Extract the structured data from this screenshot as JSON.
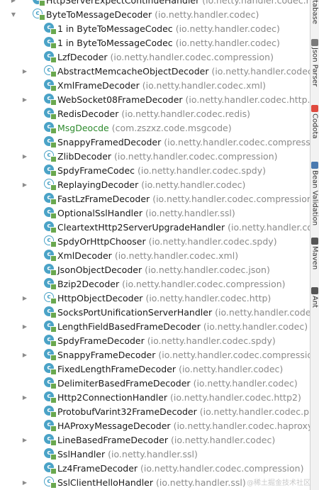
{
  "tree": {
    "rows": [
      {
        "name": "HttpServerExpectContinueHandler",
        "pkg": "(io.netty.handler.codec.http",
        "depth": 0,
        "arrow": "right",
        "icon": "class"
      },
      {
        "name": "ByteToMessageDecoder",
        "pkg": "(io.netty.handler.codec)",
        "depth": 0,
        "arrow": "down",
        "icon": "abstract"
      },
      {
        "name": "1 in ByteToMessageCodec",
        "pkg": "(io.netty.handler.codec)",
        "depth": 1,
        "arrow": "",
        "icon": "class"
      },
      {
        "name": "1 in ByteToMessageCodec",
        "pkg": "(io.netty.handler.codec)",
        "depth": 1,
        "arrow": "",
        "icon": "class"
      },
      {
        "name": "LzfDecoder",
        "pkg": "(io.netty.handler.codec.compression)",
        "depth": 1,
        "arrow": "",
        "icon": "class"
      },
      {
        "name": "AbstractMemcacheObjectDecoder",
        "pkg": "(io.netty.handler.codec.m",
        "depth": 1,
        "arrow": "right",
        "icon": "abstract"
      },
      {
        "name": "XmlFrameDecoder",
        "pkg": "(io.netty.handler.codec.xml)",
        "depth": 1,
        "arrow": "",
        "icon": "class"
      },
      {
        "name": "WebSocket08FrameDecoder",
        "pkg": "(io.netty.handler.codec.http.we",
        "depth": 1,
        "arrow": "right",
        "icon": "class"
      },
      {
        "name": "RedisDecoder",
        "pkg": "(io.netty.handler.codec.redis)",
        "depth": 1,
        "arrow": "",
        "icon": "class"
      },
      {
        "name": "MsgDeocde",
        "pkg": "(com.zszxz.code.msgcode)",
        "depth": 1,
        "arrow": "",
        "icon": "class",
        "selected": true
      },
      {
        "name": "SnappyFramedDecoder",
        "pkg": "(io.netty.handler.codec.compressio",
        "depth": 1,
        "arrow": "",
        "icon": "class"
      },
      {
        "name": "ZlibDecoder",
        "pkg": "(io.netty.handler.codec.compression)",
        "depth": 1,
        "arrow": "right",
        "icon": "abstract"
      },
      {
        "name": "SpdyFrameCodec",
        "pkg": "(io.netty.handler.codec.spdy)",
        "depth": 1,
        "arrow": "",
        "icon": "class"
      },
      {
        "name": "ReplayingDecoder",
        "pkg": "(io.netty.handler.codec)",
        "depth": 1,
        "arrow": "right",
        "icon": "abstract"
      },
      {
        "name": "FastLzFrameDecoder",
        "pkg": "(io.netty.handler.codec.compression)",
        "depth": 1,
        "arrow": "",
        "icon": "class"
      },
      {
        "name": "OptionalSslHandler",
        "pkg": "(io.netty.handler.ssl)",
        "depth": 1,
        "arrow": "",
        "icon": "class"
      },
      {
        "name": "CleartextHttp2ServerUpgradeHandler",
        "pkg": "(io.netty.handler.cod",
        "depth": 1,
        "arrow": "",
        "icon": "class"
      },
      {
        "name": "SpdyOrHttpChooser",
        "pkg": "(io.netty.handler.codec.spdy)",
        "depth": 1,
        "arrow": "",
        "icon": "abstract"
      },
      {
        "name": "XmlDecoder",
        "pkg": "(io.netty.handler.codec.xml)",
        "depth": 1,
        "arrow": "",
        "icon": "class"
      },
      {
        "name": "JsonObjectDecoder",
        "pkg": "(io.netty.handler.codec.json)",
        "depth": 1,
        "arrow": "",
        "icon": "class"
      },
      {
        "name": "Bzip2Decoder",
        "pkg": "(io.netty.handler.codec.compression)",
        "depth": 1,
        "arrow": "",
        "icon": "class"
      },
      {
        "name": "HttpObjectDecoder",
        "pkg": "(io.netty.handler.codec.http)",
        "depth": 1,
        "arrow": "right",
        "icon": "abstract"
      },
      {
        "name": "SocksPortUnificationServerHandler",
        "pkg": "(io.netty.handler.codec.",
        "depth": 1,
        "arrow": "",
        "icon": "class"
      },
      {
        "name": "LengthFieldBasedFrameDecoder",
        "pkg": "(io.netty.handler.codec)",
        "depth": 1,
        "arrow": "right",
        "icon": "class"
      },
      {
        "name": "SpdyFrameDecoder",
        "pkg": "(io.netty.handler.codec.spdy)",
        "depth": 1,
        "arrow": "",
        "icon": "class"
      },
      {
        "name": "SnappyFrameDecoder",
        "pkg": "(io.netty.handler.codec.compression",
        "depth": 1,
        "arrow": "right",
        "icon": "class"
      },
      {
        "name": "FixedLengthFrameDecoder",
        "pkg": "(io.netty.handler.codec)",
        "depth": 1,
        "arrow": "",
        "icon": "class"
      },
      {
        "name": "DelimiterBasedFrameDecoder",
        "pkg": "(io.netty.handler.codec)",
        "depth": 1,
        "arrow": "",
        "icon": "class"
      },
      {
        "name": "Http2ConnectionHandler",
        "pkg": "(io.netty.handler.codec.http2)",
        "depth": 1,
        "arrow": "right",
        "icon": "class"
      },
      {
        "name": "ProtobufVarint32FrameDecoder",
        "pkg": "(io.netty.handler.codec.pro",
        "depth": 1,
        "arrow": "",
        "icon": "class"
      },
      {
        "name": "HAProxyMessageDecoder",
        "pkg": "(io.netty.handler.codec.haproxy)",
        "depth": 1,
        "arrow": "",
        "icon": "class"
      },
      {
        "name": "LineBasedFrameDecoder",
        "pkg": "(io.netty.handler.codec)",
        "depth": 1,
        "arrow": "right",
        "icon": "class"
      },
      {
        "name": "SslHandler",
        "pkg": "(io.netty.handler.ssl)",
        "depth": 1,
        "arrow": "",
        "icon": "class"
      },
      {
        "name": "Lz4FrameDecoder",
        "pkg": "(io.netty.handler.codec.compression)",
        "depth": 1,
        "arrow": "",
        "icon": "class"
      },
      {
        "name": "SslClientHelloHandler",
        "pkg": "(io.netty.handler.ssl)",
        "depth": 1,
        "arrow": "right",
        "icon": "abstract"
      }
    ]
  },
  "sidebar": {
    "tools": [
      {
        "label": "atabase",
        "icon": "database-icon",
        "color": "#7a7a7a"
      },
      {
        "label": "Json Parser",
        "icon": "json-parser-icon",
        "color": "#7a7a7a"
      },
      {
        "label": "Codota",
        "icon": "codota-icon",
        "color": "#e04a3f"
      },
      {
        "label": "Bean Validation",
        "icon": "bean-validation-icon",
        "color": "#4a7ab0"
      },
      {
        "label": "Maven",
        "icon": "maven-icon",
        "color": "#555555"
      },
      {
        "label": "Ant",
        "icon": "ant-icon",
        "color": "#555555"
      }
    ]
  },
  "watermark": "@稀土掘金技术社区",
  "colors": {
    "class_icon": "#4ba3c7",
    "access_badge": "#6aa84f",
    "package_text": "#8a8a8a",
    "selected_text": "#2d8a2d"
  }
}
